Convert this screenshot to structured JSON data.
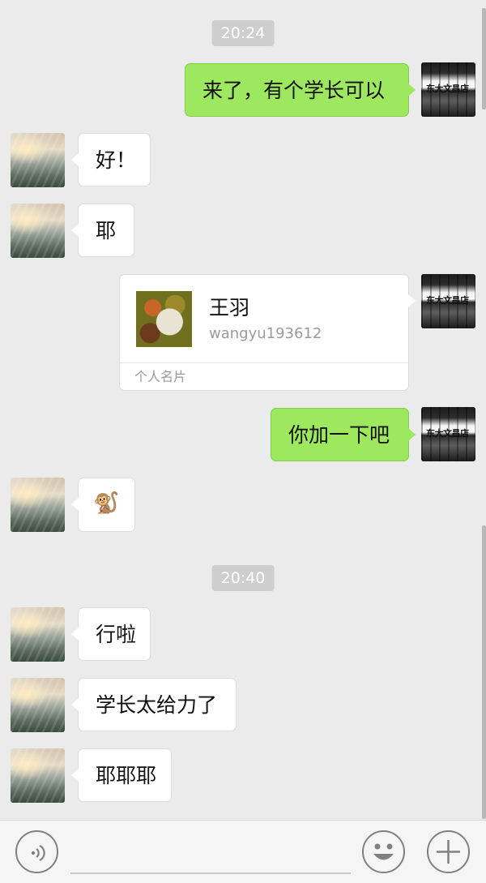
{
  "timestamps": [
    "20:24",
    "20:40"
  ],
  "messages": {
    "m1": "来了，有个学长可以",
    "m2": "好！",
    "m3": "耶",
    "m5": "你加一下吧",
    "m6_emoji": "🐒",
    "m7": "行啦",
    "m8": "学长太给力了",
    "m9": "耶耶耶"
  },
  "contact_card": {
    "name": "王羽",
    "id": "wangyu193612",
    "label": "个人名片"
  },
  "self_avatar_text": "东大文昌店",
  "input_bar": {
    "placeholder": "",
    "icons": [
      "voice-icon",
      "emoji-icon",
      "plus-icon"
    ]
  },
  "colors": {
    "background": "#ebebeb",
    "outgoing_bubble": "#9ee85f",
    "incoming_bubble": "#ffffff",
    "timestamp_bg": "#cecece"
  }
}
